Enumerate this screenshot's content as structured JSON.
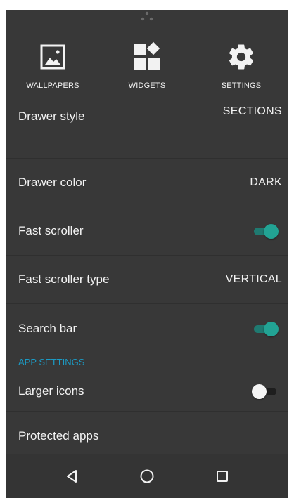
{
  "colors": {
    "background": "#383838",
    "accent": "#22a394",
    "section_header": "#1b9bc5",
    "text": "#f3f3f3"
  },
  "shortcuts": [
    {
      "label": "WALLPAPERS",
      "icon": "wallpaper-icon"
    },
    {
      "label": "WIDGETS",
      "icon": "widgets-icon"
    },
    {
      "label": "SETTINGS",
      "icon": "gear-icon"
    }
  ],
  "settings": {
    "drawer_style": {
      "title": "Drawer style",
      "value": "SECTIONS"
    },
    "drawer_color": {
      "title": "Drawer color",
      "value": "DARK"
    },
    "fast_scroller": {
      "title": "Fast scroller",
      "enabled": true
    },
    "fast_scroller_type": {
      "title": "Fast scroller type",
      "value": "VERTICAL"
    },
    "search_bar": {
      "title": "Search bar",
      "enabled": true
    },
    "app_settings_header": "APP SETTINGS",
    "larger_icons": {
      "title": "Larger icons",
      "enabled": false
    },
    "protected_apps": {
      "title": "Protected apps"
    }
  },
  "navbar": {
    "back": "back-icon",
    "home": "home-icon",
    "recents": "recents-icon"
  }
}
